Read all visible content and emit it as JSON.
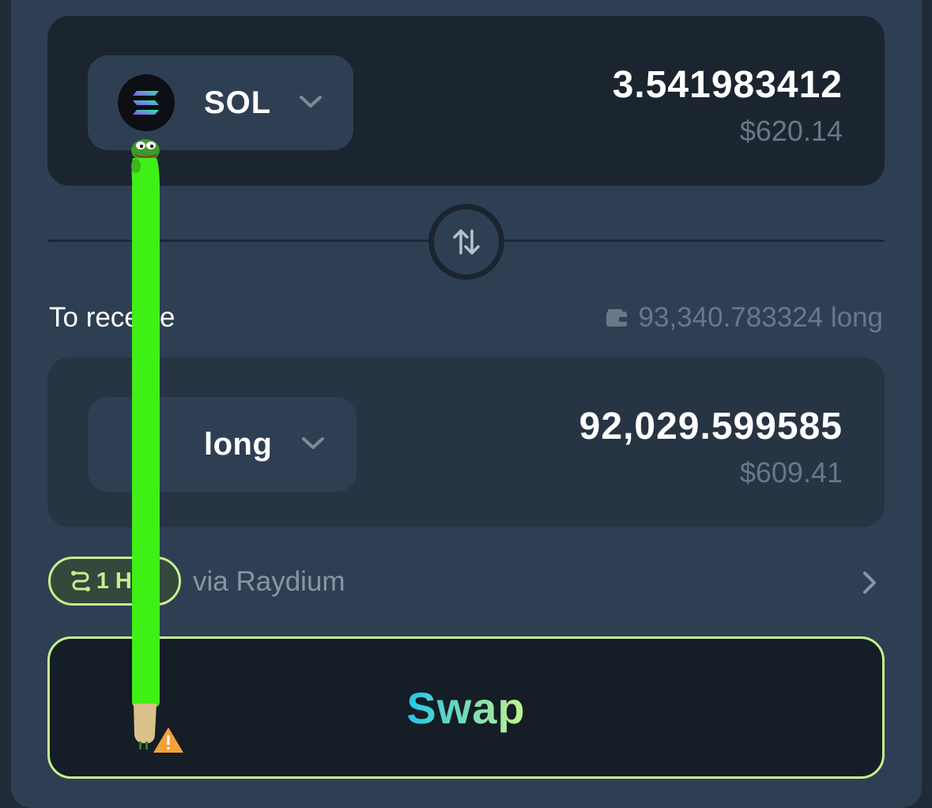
{
  "pay": {
    "token_symbol": "SOL",
    "amount": "3.541983412",
    "usd_value": "$620.14",
    "token_icon": "solana-logo-icon"
  },
  "receive": {
    "label": "To receive",
    "wallet_balance": "93,340.783324 long",
    "token_symbol": "long",
    "amount": "92,029.599585",
    "usd_value": "$609.41"
  },
  "route": {
    "hops_label": "1 Hop",
    "via_text": "via Raydium"
  },
  "swap_button_label": "Swap",
  "colors": {
    "accent": "#c5f08f",
    "gradient_start": "#22c6e8",
    "gradient_end": "#c7f28e",
    "overlay_green": "#3ff016",
    "warning": "#f2a23a"
  }
}
